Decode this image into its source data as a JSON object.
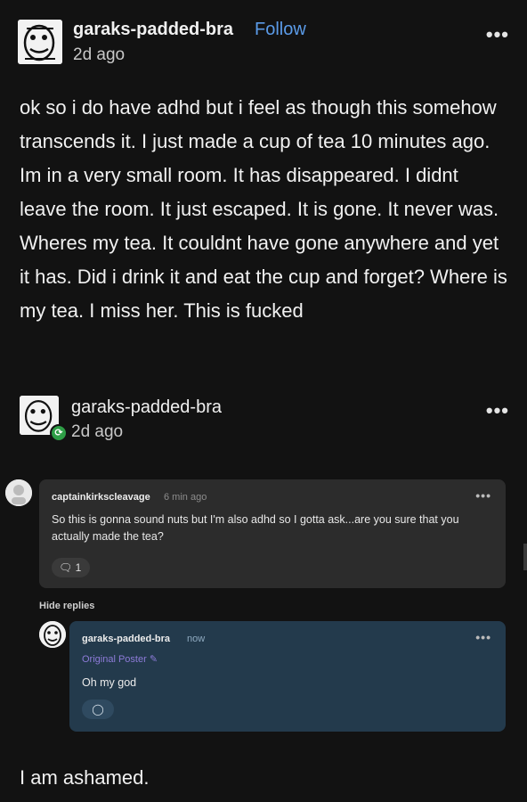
{
  "post": {
    "username": "garaks-padded-bra",
    "follow_label": "Follow",
    "timestamp": "2d ago",
    "more_label": "•••",
    "body": "ok so i do have adhd but i feel as though this somehow transcends it. I just made a cup of tea 10 minutes ago. Im in a very small room. It has disappeared. I didnt leave the room. It just escaped. It is gone. It never was. Wheres my tea. It couldnt have gone anywhere and yet it has. Did i drink it and eat the cup and forget? Where is my tea. I miss her. This is fucked"
  },
  "reblog": {
    "username": "garaks-padded-bra",
    "timestamp": "2d ago",
    "more_label": "•••",
    "badge_icon": "reblog-icon"
  },
  "comment": {
    "username": "captainkirkscleavage",
    "time": "6 min ago",
    "more_label": "•••",
    "text": "So this is gonna sound nuts but I'm also adhd so I gotta ask...are you sure that you actually made the tea?",
    "reply_count": "1"
  },
  "hide_replies_label": "Hide replies",
  "reply": {
    "username": "garaks-padded-bra",
    "time": "now",
    "op_label": "Original Poster",
    "text": "Oh my god",
    "more_label": "•••"
  },
  "footer_text": "I am ashamed.",
  "colors": {
    "background": "#121212",
    "follow": "#5b9be8",
    "reply_bg": "#233a4c",
    "op_badge": "#8d7bd8"
  }
}
